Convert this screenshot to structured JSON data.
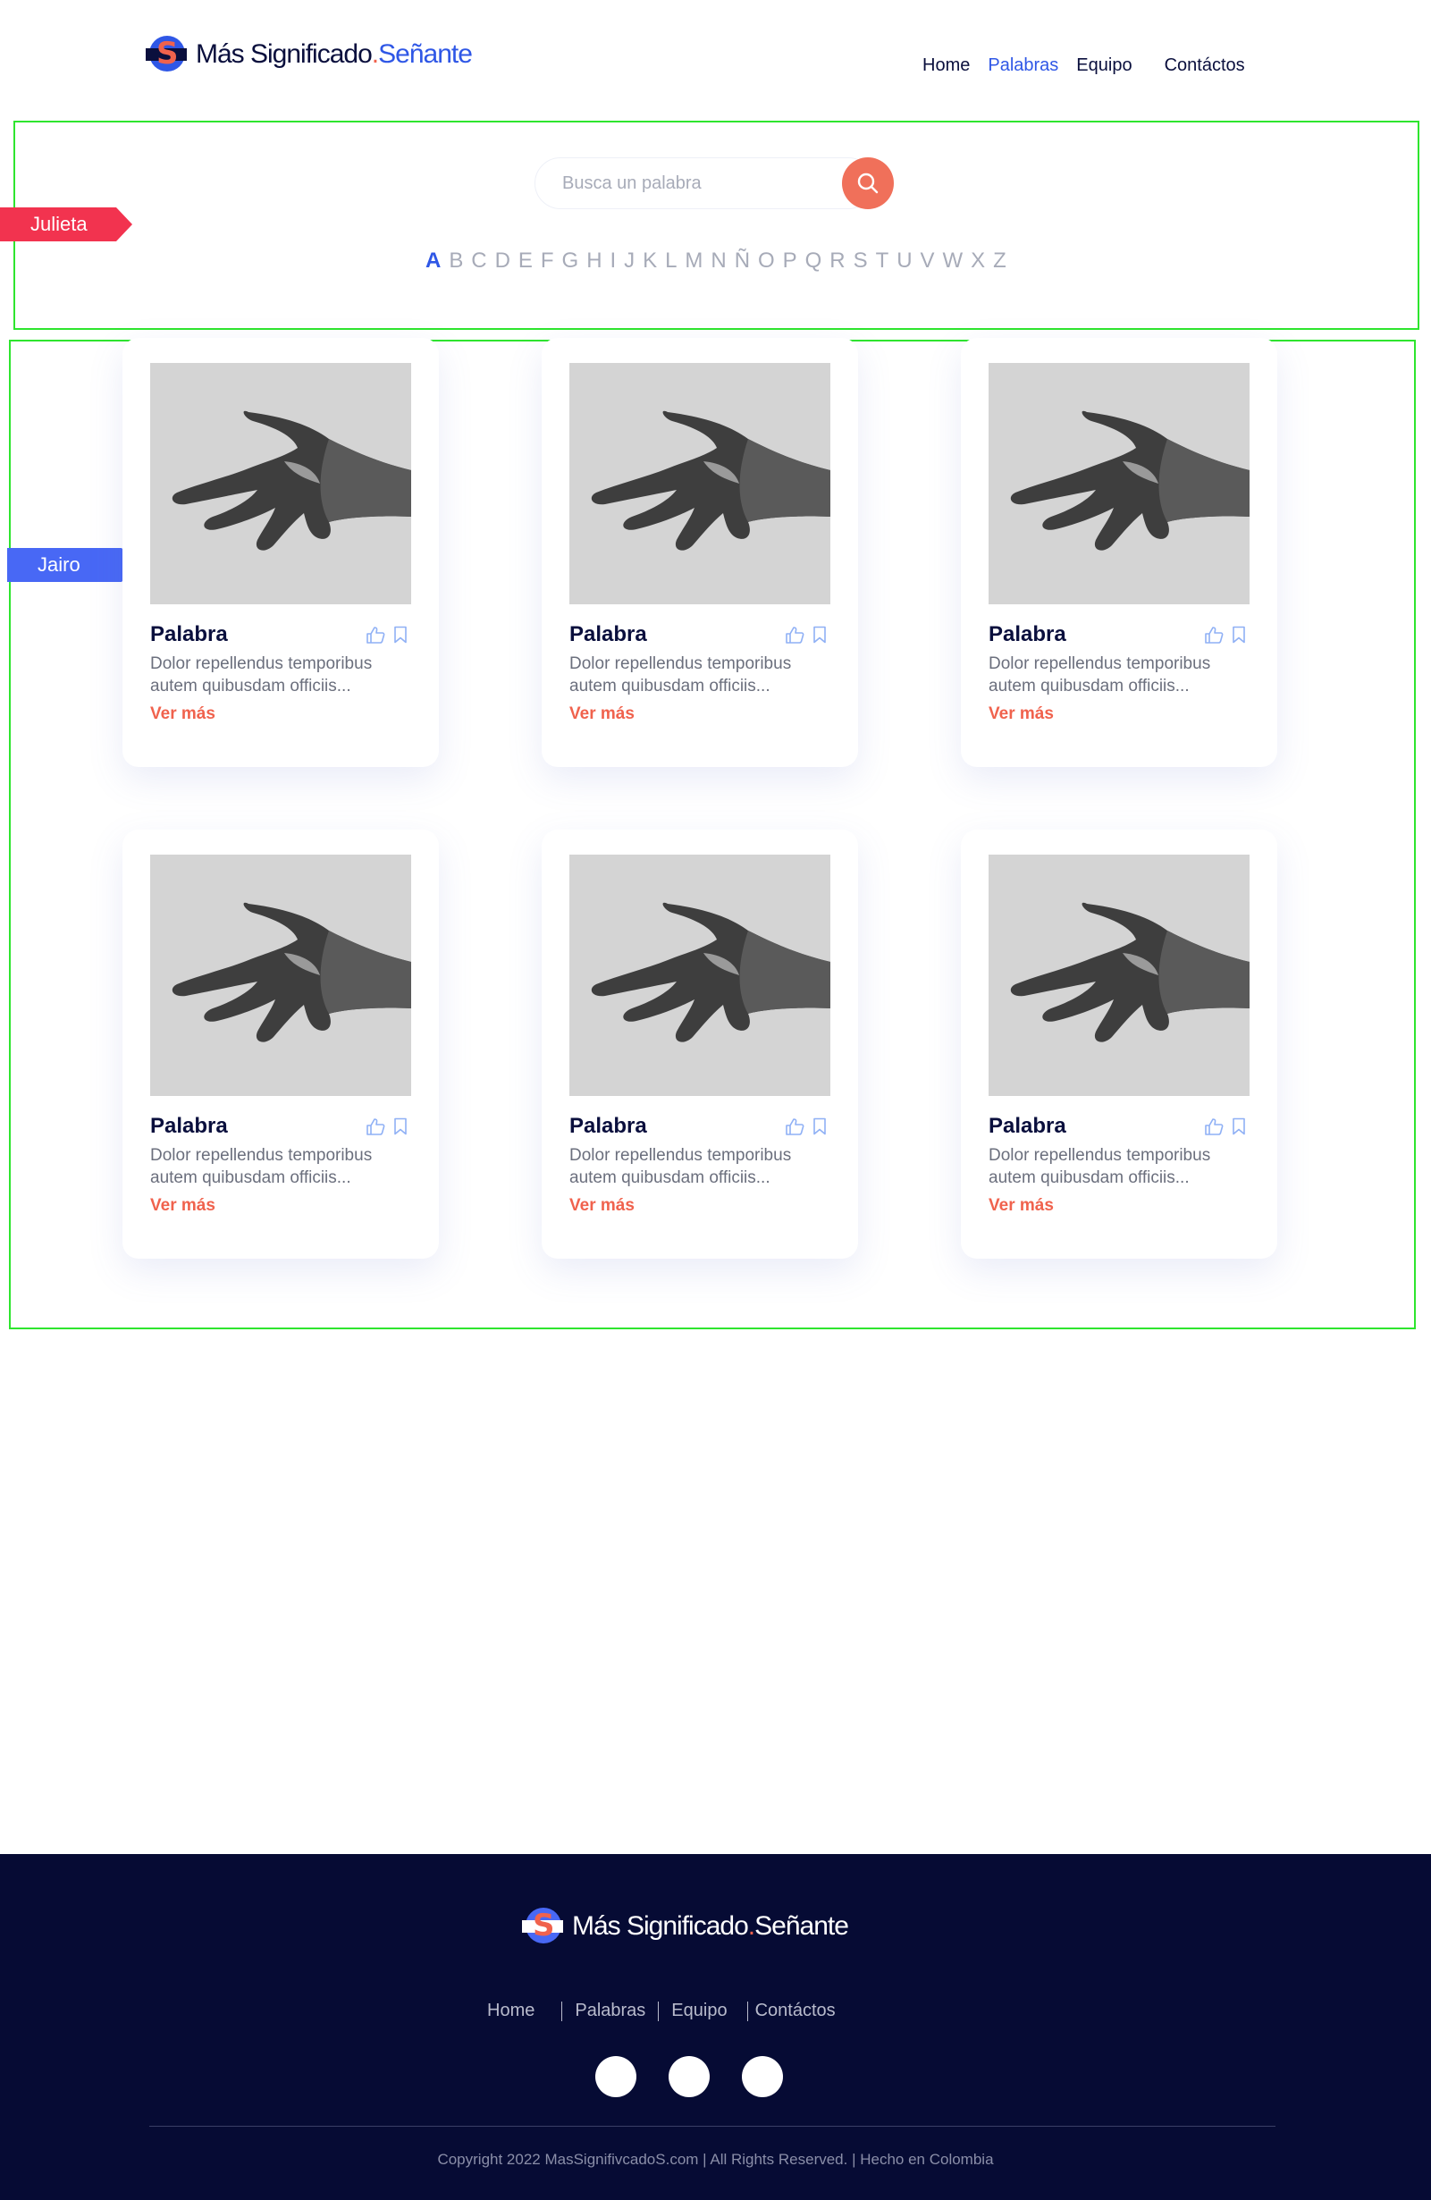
{
  "brand": {
    "part1": "Más Significado",
    "dot": ".",
    "part2": "Señante",
    "mark": "S"
  },
  "nav": {
    "home": "Home",
    "palabras": "Palabras",
    "equipo": "Equipo",
    "contactos": "Contáctos",
    "active": "palabras"
  },
  "annotations": {
    "tag1": "Julieta",
    "tag2": "Jairo"
  },
  "search": {
    "placeholder": "Busca un palabra",
    "icon": "search-icon"
  },
  "alphabet": {
    "active": "A",
    "letters": [
      "A",
      "B",
      "C",
      "D",
      "E",
      "F",
      "G",
      "H",
      "I",
      "J",
      "K",
      "L",
      "M",
      "N",
      "Ñ",
      "O",
      "P",
      "Q",
      "R",
      "S",
      "T",
      "U",
      "V",
      "W",
      "X",
      "Z"
    ]
  },
  "cards": [
    {
      "title": "Palabra",
      "desc": "Dolor repellendus temporibus autem quibusdam officiis...",
      "more": "Ver más"
    },
    {
      "title": "Palabra",
      "desc": "Dolor repellendus temporibus autem quibusdam officiis...",
      "more": "Ver más"
    },
    {
      "title": "Palabra",
      "desc": "Dolor repellendus temporibus autem quibusdam officiis...",
      "more": "Ver más"
    },
    {
      "title": "Palabra",
      "desc": "Dolor repellendus temporibus autem quibusdam officiis...",
      "more": "Ver más"
    },
    {
      "title": "Palabra",
      "desc": "Dolor repellendus temporibus autem quibusdam officiis...",
      "more": "Ver más"
    },
    {
      "title": "Palabra",
      "desc": "Dolor repellendus temporibus autem quibusdam officiis...",
      "more": "Ver más"
    }
  ],
  "footer": {
    "nav": {
      "home": "Home",
      "palabras": "Palabras",
      "equipo": "Equipo",
      "contactos": "Contáctos"
    },
    "copyright": "Copyright 2022 MasSignifivcadoS.com | All Rights Reserved.  |  Hecho en Colombia"
  },
  "colors": {
    "primary": "#2f57e6",
    "accent": "#f0624d",
    "dark": "#060b34",
    "annotation": "#2ee52e"
  }
}
